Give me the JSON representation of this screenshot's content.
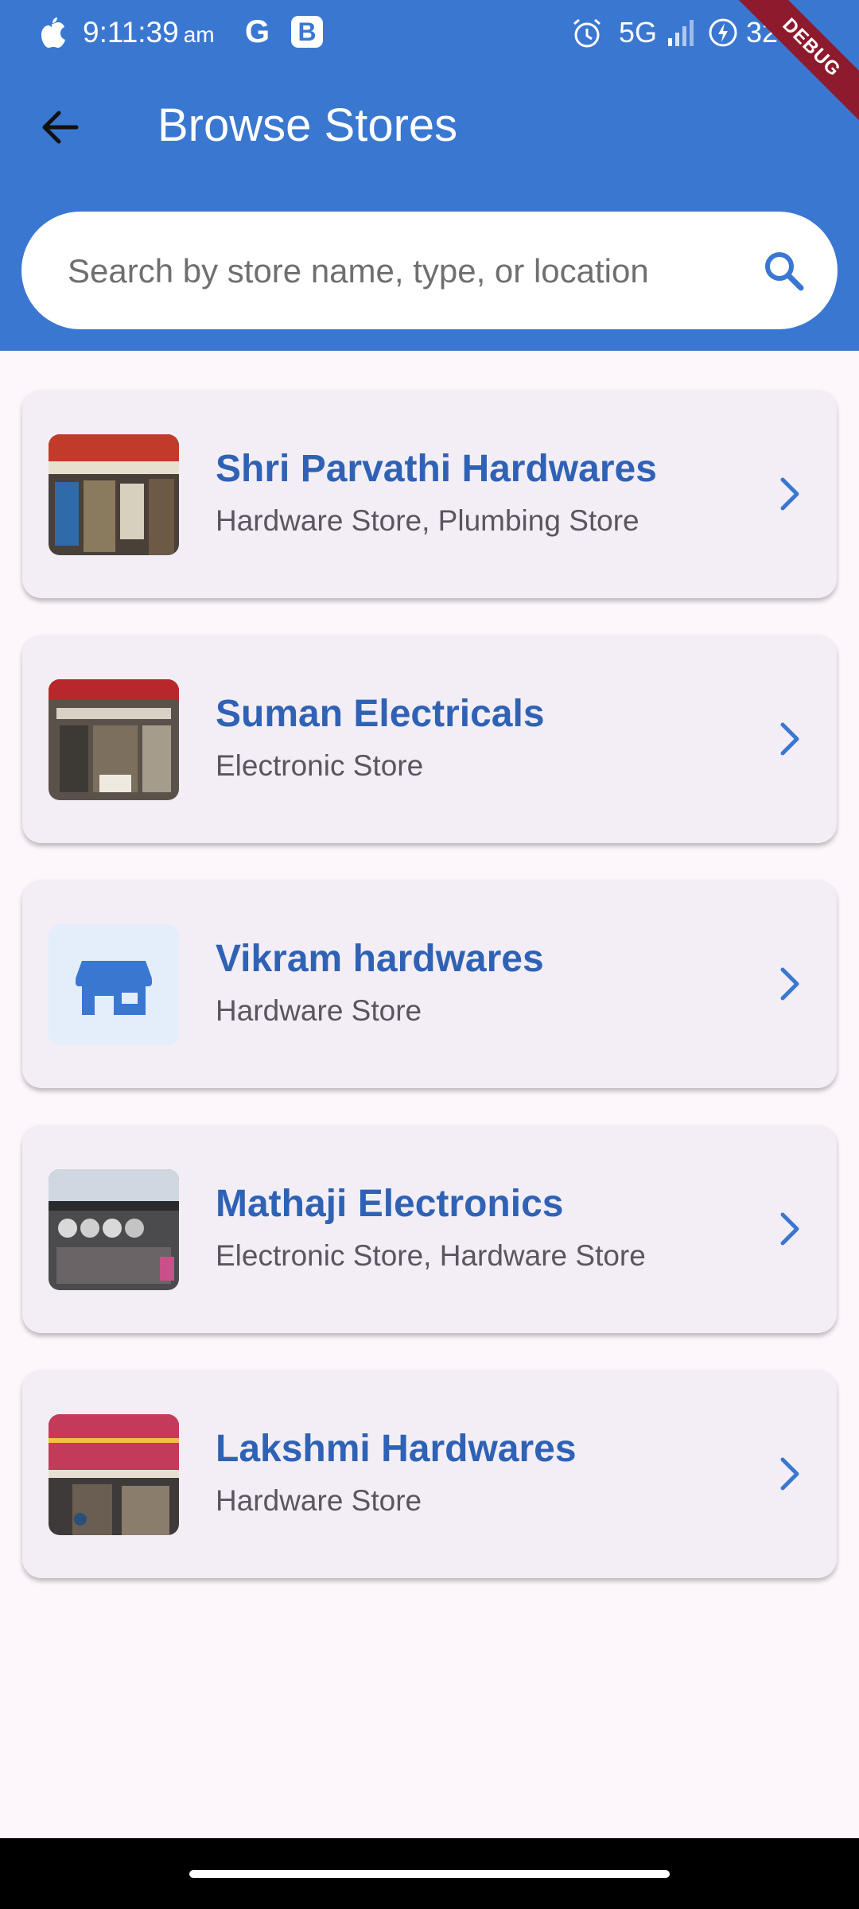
{
  "status_bar": {
    "time": "9:11:39",
    "ampm": "am",
    "network": "5G",
    "battery": "32",
    "icons": [
      "apple-icon",
      "google-icon",
      "b-app-icon",
      "alarm-icon",
      "signal-icon",
      "charging-icon"
    ]
  },
  "debug_label": "DEBUG",
  "header": {
    "title": "Browse Stores",
    "back_icon": "arrow-back-icon"
  },
  "search": {
    "placeholder": "Search by store name, type, or location",
    "value": "",
    "icon": "search-icon"
  },
  "stores": [
    {
      "name": "Shri Parvathi Hardwares",
      "types": "Hardware Store, Plumbing Store",
      "thumb": "photo"
    },
    {
      "name": "Suman Electricals",
      "types": "Electronic Store",
      "thumb": "photo"
    },
    {
      "name": "Vikram hardwares",
      "types": "Hardware Store",
      "thumb": "store-icon"
    },
    {
      "name": "Mathaji Electronics",
      "types": "Electronic Store, Hardware Store",
      "thumb": "photo"
    },
    {
      "name": "Lakshmi Hardwares",
      "types": "Hardware Store",
      "thumb": "photo"
    }
  ],
  "colors": {
    "primary": "#3a77d1",
    "title_blue": "#2f62b5",
    "card_bg": "#f3eef5",
    "page_bg": "#fdf7fb",
    "debug_ribbon": "#8e1a2e"
  }
}
